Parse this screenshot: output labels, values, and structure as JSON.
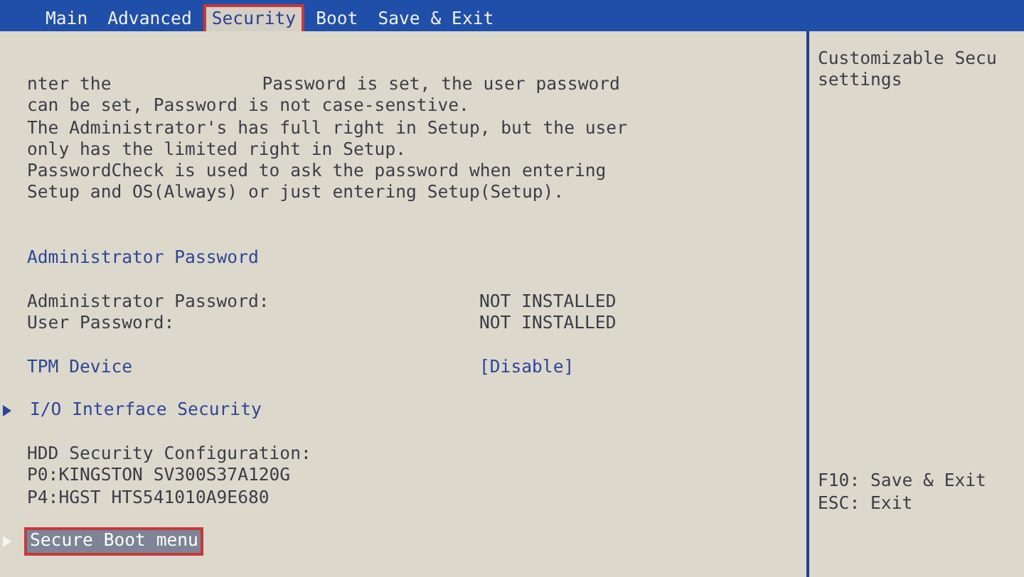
{
  "tabs": [
    {
      "label": "Main",
      "selected": false
    },
    {
      "label": "Advanced",
      "selected": false
    },
    {
      "label": "Security",
      "selected": true
    },
    {
      "label": "Boot",
      "selected": false
    },
    {
      "label": "Save & Exit",
      "selected": false
    }
  ],
  "description": {
    "first_line": [
      "nter the",
      "Password is set, the user password"
    ],
    "lines": [
      "can be set, Password is not case-senstive.",
      "The Administrator's has full right in Setup, but the user",
      "only has the limited right in Setup.",
      "PasswordCheck is used to ask the password when entering",
      "Setup and OS(Always) or just entering Setup(Setup)."
    ]
  },
  "groups": [
    [
      {
        "kind": "heading",
        "label": "Administrator Password"
      }
    ],
    [
      {
        "kind": "info",
        "label": "Administrator Password:",
        "value": "NOT INSTALLED"
      },
      {
        "kind": "info",
        "label": "User Password:",
        "value": "NOT INSTALLED"
      }
    ],
    [
      {
        "kind": "setting",
        "label": "TPM Device",
        "value": "[Disable]"
      }
    ],
    [
      {
        "kind": "submenu",
        "label": "I/O Interface Security",
        "selected": false
      }
    ],
    [
      {
        "kind": "info",
        "label": "HDD Security Configuration:"
      },
      {
        "kind": "info",
        "label": "P0:KINGSTON SV300S37A120G"
      },
      {
        "kind": "info",
        "label": "P4:HGST HTS541010A9E680"
      }
    ],
    [
      {
        "kind": "submenu",
        "label": "Secure Boot menu",
        "selected": true
      }
    ]
  ],
  "help": [
    "Customizable Secu",
    "settings"
  ],
  "keys": [
    "F10: Save & Exit",
    "ESC: Exit"
  ]
}
